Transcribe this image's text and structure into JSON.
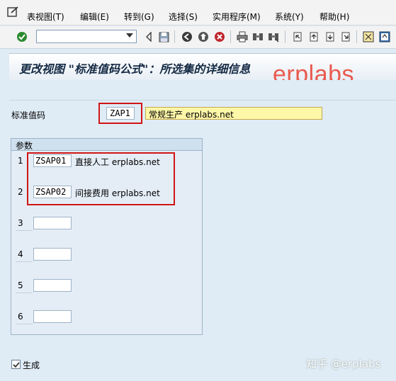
{
  "menu": {
    "items": [
      "表视图(T)",
      "编辑(E)",
      "转到(G)",
      "选择(S)",
      "实用程序(M)",
      "系统(Y)",
      "帮助(H)"
    ]
  },
  "toolbar": {
    "command_value": "",
    "icons": [
      "enter-check-icon",
      "back-arrow-icon",
      "save-icon",
      "back-icon",
      "exit-icon",
      "cancel-icon",
      "print-icon",
      "find-icon",
      "find-next-icon",
      "first-page-icon",
      "prev-page-icon",
      "next-page-icon",
      "last-page-icon",
      "create-session-icon",
      "help-icon"
    ]
  },
  "title": "更改视图 \"标准值码公式\"：所选集的详细信息",
  "watermark": "erplabs",
  "form": {
    "std_code_label": "标准值码",
    "std_code_value": "ZAP1",
    "std_code_desc": "常规生产 erplabs.net"
  },
  "params": {
    "title": "参数",
    "rows": [
      {
        "num": "1",
        "code": "ZSAP01",
        "desc": "直接人工 erplabs.net"
      },
      {
        "num": "2",
        "code": "ZSAP02",
        "desc": "间接费用 erplabs.net"
      },
      {
        "num": "3",
        "code": "",
        "desc": ""
      },
      {
        "num": "4",
        "code": "",
        "desc": ""
      },
      {
        "num": "5",
        "code": "",
        "desc": ""
      },
      {
        "num": "6",
        "code": "",
        "desc": ""
      }
    ]
  },
  "generate": {
    "label": "生成",
    "checked": true
  },
  "footer_watermark": "知乎 @erplabs",
  "colors": {
    "accent_red": "#d01515",
    "watermark_red": "#e95a4f",
    "background": "#dfebf5"
  }
}
